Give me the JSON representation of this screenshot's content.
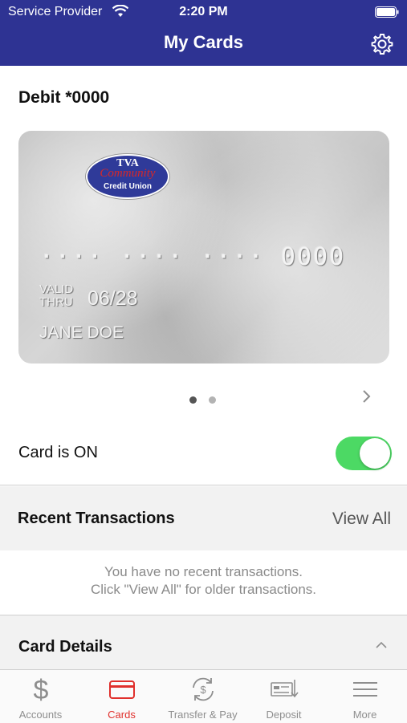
{
  "status_bar": {
    "provider": "Service Provider",
    "time": "2:20 PM"
  },
  "header": {
    "title": "My Cards",
    "settings_icon": "gear-icon"
  },
  "card": {
    "name": "Debit *0000",
    "logo": {
      "line1": "TVA",
      "line2": "Community",
      "line3": "Credit Union"
    },
    "number": "···· ···· ···· 0000",
    "valid_label_1": "VALID",
    "valid_label_2": "THRU",
    "expiry": "06/28",
    "holder": "JANE DOE"
  },
  "pager": {
    "count": 2,
    "active": 0
  },
  "toggle": {
    "label": "Card is ON",
    "on": true,
    "color": "#4cd964"
  },
  "recent": {
    "title": "Recent Transactions",
    "view_all": "View All",
    "empty_line1": "You have no recent transactions.",
    "empty_line2": "Click \"View All\" for older transactions."
  },
  "details": {
    "title": "Card Details"
  },
  "tabs": [
    {
      "label": "Accounts",
      "icon": "dollar-icon",
      "active": false
    },
    {
      "label": "Cards",
      "icon": "card-icon",
      "active": true
    },
    {
      "label": "Transfer & Pay",
      "icon": "transfer-icon",
      "active": false
    },
    {
      "label": "Deposit",
      "icon": "check-deposit-icon",
      "active": false
    },
    {
      "label": "More",
      "icon": "menu-icon",
      "active": false
    }
  ],
  "colors": {
    "header": "#2e3393",
    "accent": "#e0302c"
  }
}
